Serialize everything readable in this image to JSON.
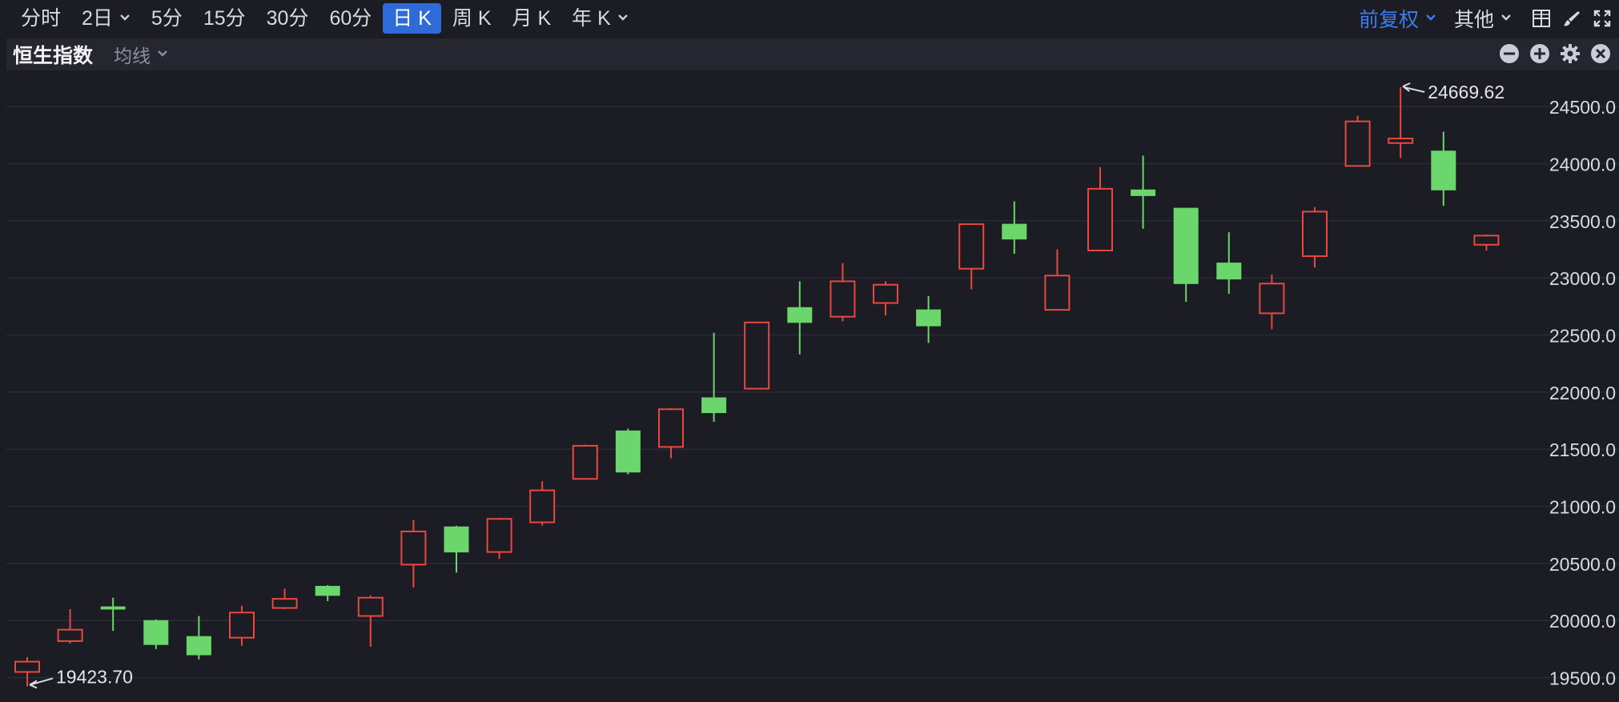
{
  "toolbar": {
    "periods": [
      {
        "label": "分时",
        "active": false,
        "dropdown": false
      },
      {
        "label": "2日",
        "active": false,
        "dropdown": true
      },
      {
        "label": "5分",
        "active": false,
        "dropdown": false
      },
      {
        "label": "15分",
        "active": false,
        "dropdown": false
      },
      {
        "label": "30分",
        "active": false,
        "dropdown": false
      },
      {
        "label": "60分",
        "active": false,
        "dropdown": false
      },
      {
        "label": "日 K",
        "active": true,
        "dropdown": false
      },
      {
        "label": "周 K",
        "active": false,
        "dropdown": false
      },
      {
        "label": "月 K",
        "active": false,
        "dropdown": false
      },
      {
        "label": "年 K",
        "active": false,
        "dropdown": true
      }
    ],
    "adjust_label": "前复权",
    "other_label": "其他"
  },
  "panel": {
    "index_name": "恒生指数",
    "ma_label": "均线"
  },
  "colors": {
    "up": "#e8483f",
    "down": "#6bd66b",
    "accent": "#2f6bd8",
    "background": "#1b1c24",
    "grid": "#2a2b34"
  },
  "chart_data": {
    "type": "candlestick",
    "title": "恒生指数",
    "y_ticks": [
      "19500.0",
      "20000.0",
      "20500.0",
      "21000.0",
      "21500.0",
      "22000.0",
      "22500.0",
      "23000.0",
      "23500.0",
      "24000.0",
      "24500.0"
    ],
    "ylim": [
      19420,
      24760
    ],
    "grid": true,
    "annotations": {
      "max_label": "24669.62",
      "min_label": "19423.70"
    },
    "candles": [
      {
        "open": 19550,
        "close": 19640,
        "high": 19680,
        "low": 19423.7
      },
      {
        "open": 19820,
        "close": 19920,
        "high": 20100,
        "low": 19800
      },
      {
        "open": 20120,
        "close": 20100,
        "high": 20200,
        "low": 19910
      },
      {
        "open": 20000,
        "close": 19790,
        "high": 20010,
        "low": 19750
      },
      {
        "open": 19860,
        "close": 19700,
        "high": 20040,
        "low": 19660
      },
      {
        "open": 19850,
        "close": 20070,
        "high": 20130,
        "low": 19780
      },
      {
        "open": 20110,
        "close": 20190,
        "high": 20280,
        "low": 20100
      },
      {
        "open": 20300,
        "close": 20220,
        "high": 20310,
        "low": 20170
      },
      {
        "open": 20040,
        "close": 20200,
        "high": 20220,
        "low": 19770
      },
      {
        "open": 20490,
        "close": 20780,
        "high": 20880,
        "low": 20290
      },
      {
        "open": 20820,
        "close": 20600,
        "high": 20830,
        "low": 20420
      },
      {
        "open": 20600,
        "close": 20890,
        "high": 20900,
        "low": 20540
      },
      {
        "open": 20860,
        "close": 21140,
        "high": 21220,
        "low": 20830
      },
      {
        "open": 21240,
        "close": 21530,
        "high": 21540,
        "low": 21240
      },
      {
        "open": 21660,
        "close": 21300,
        "high": 21680,
        "low": 21280
      },
      {
        "open": 21520,
        "close": 21850,
        "high": 21860,
        "low": 21420
      },
      {
        "open": 21950,
        "close": 21820,
        "high": 22520,
        "low": 21740
      },
      {
        "open": 22030,
        "close": 22610,
        "high": 22610,
        "low": 22030
      },
      {
        "open": 22740,
        "close": 22610,
        "high": 22970,
        "low": 22330
      },
      {
        "open": 22660,
        "close": 22970,
        "high": 23130,
        "low": 22620
      },
      {
        "open": 22780,
        "close": 22940,
        "high": 22970,
        "low": 22670
      },
      {
        "open": 22720,
        "close": 22580,
        "high": 22840,
        "low": 22430
      },
      {
        "open": 23080,
        "close": 23470,
        "high": 23470,
        "low": 22900
      },
      {
        "open": 23470,
        "close": 23340,
        "high": 23670,
        "low": 23210
      },
      {
        "open": 22720,
        "close": 23020,
        "high": 23250,
        "low": 22720
      },
      {
        "open": 23240,
        "close": 23780,
        "high": 23970,
        "low": 23240
      },
      {
        "open": 23770,
        "close": 23720,
        "high": 24070,
        "low": 23430
      },
      {
        "open": 23610,
        "close": 22950,
        "high": 23610,
        "low": 22790
      },
      {
        "open": 23130,
        "close": 22990,
        "high": 23400,
        "low": 22860
      },
      {
        "open": 22690,
        "close": 22950,
        "high": 23030,
        "low": 22550
      },
      {
        "open": 23190,
        "close": 23580,
        "high": 23620,
        "low": 23090
      },
      {
        "open": 23980,
        "close": 24370,
        "high": 24420,
        "low": 23980
      },
      {
        "open": 24180,
        "close": 24220,
        "high": 24669.62,
        "low": 24050
      },
      {
        "open": 24110,
        "close": 23770,
        "high": 24280,
        "low": 23630
      },
      {
        "open": 23290,
        "close": 23370,
        "high": 23380,
        "low": 23240
      }
    ]
  }
}
